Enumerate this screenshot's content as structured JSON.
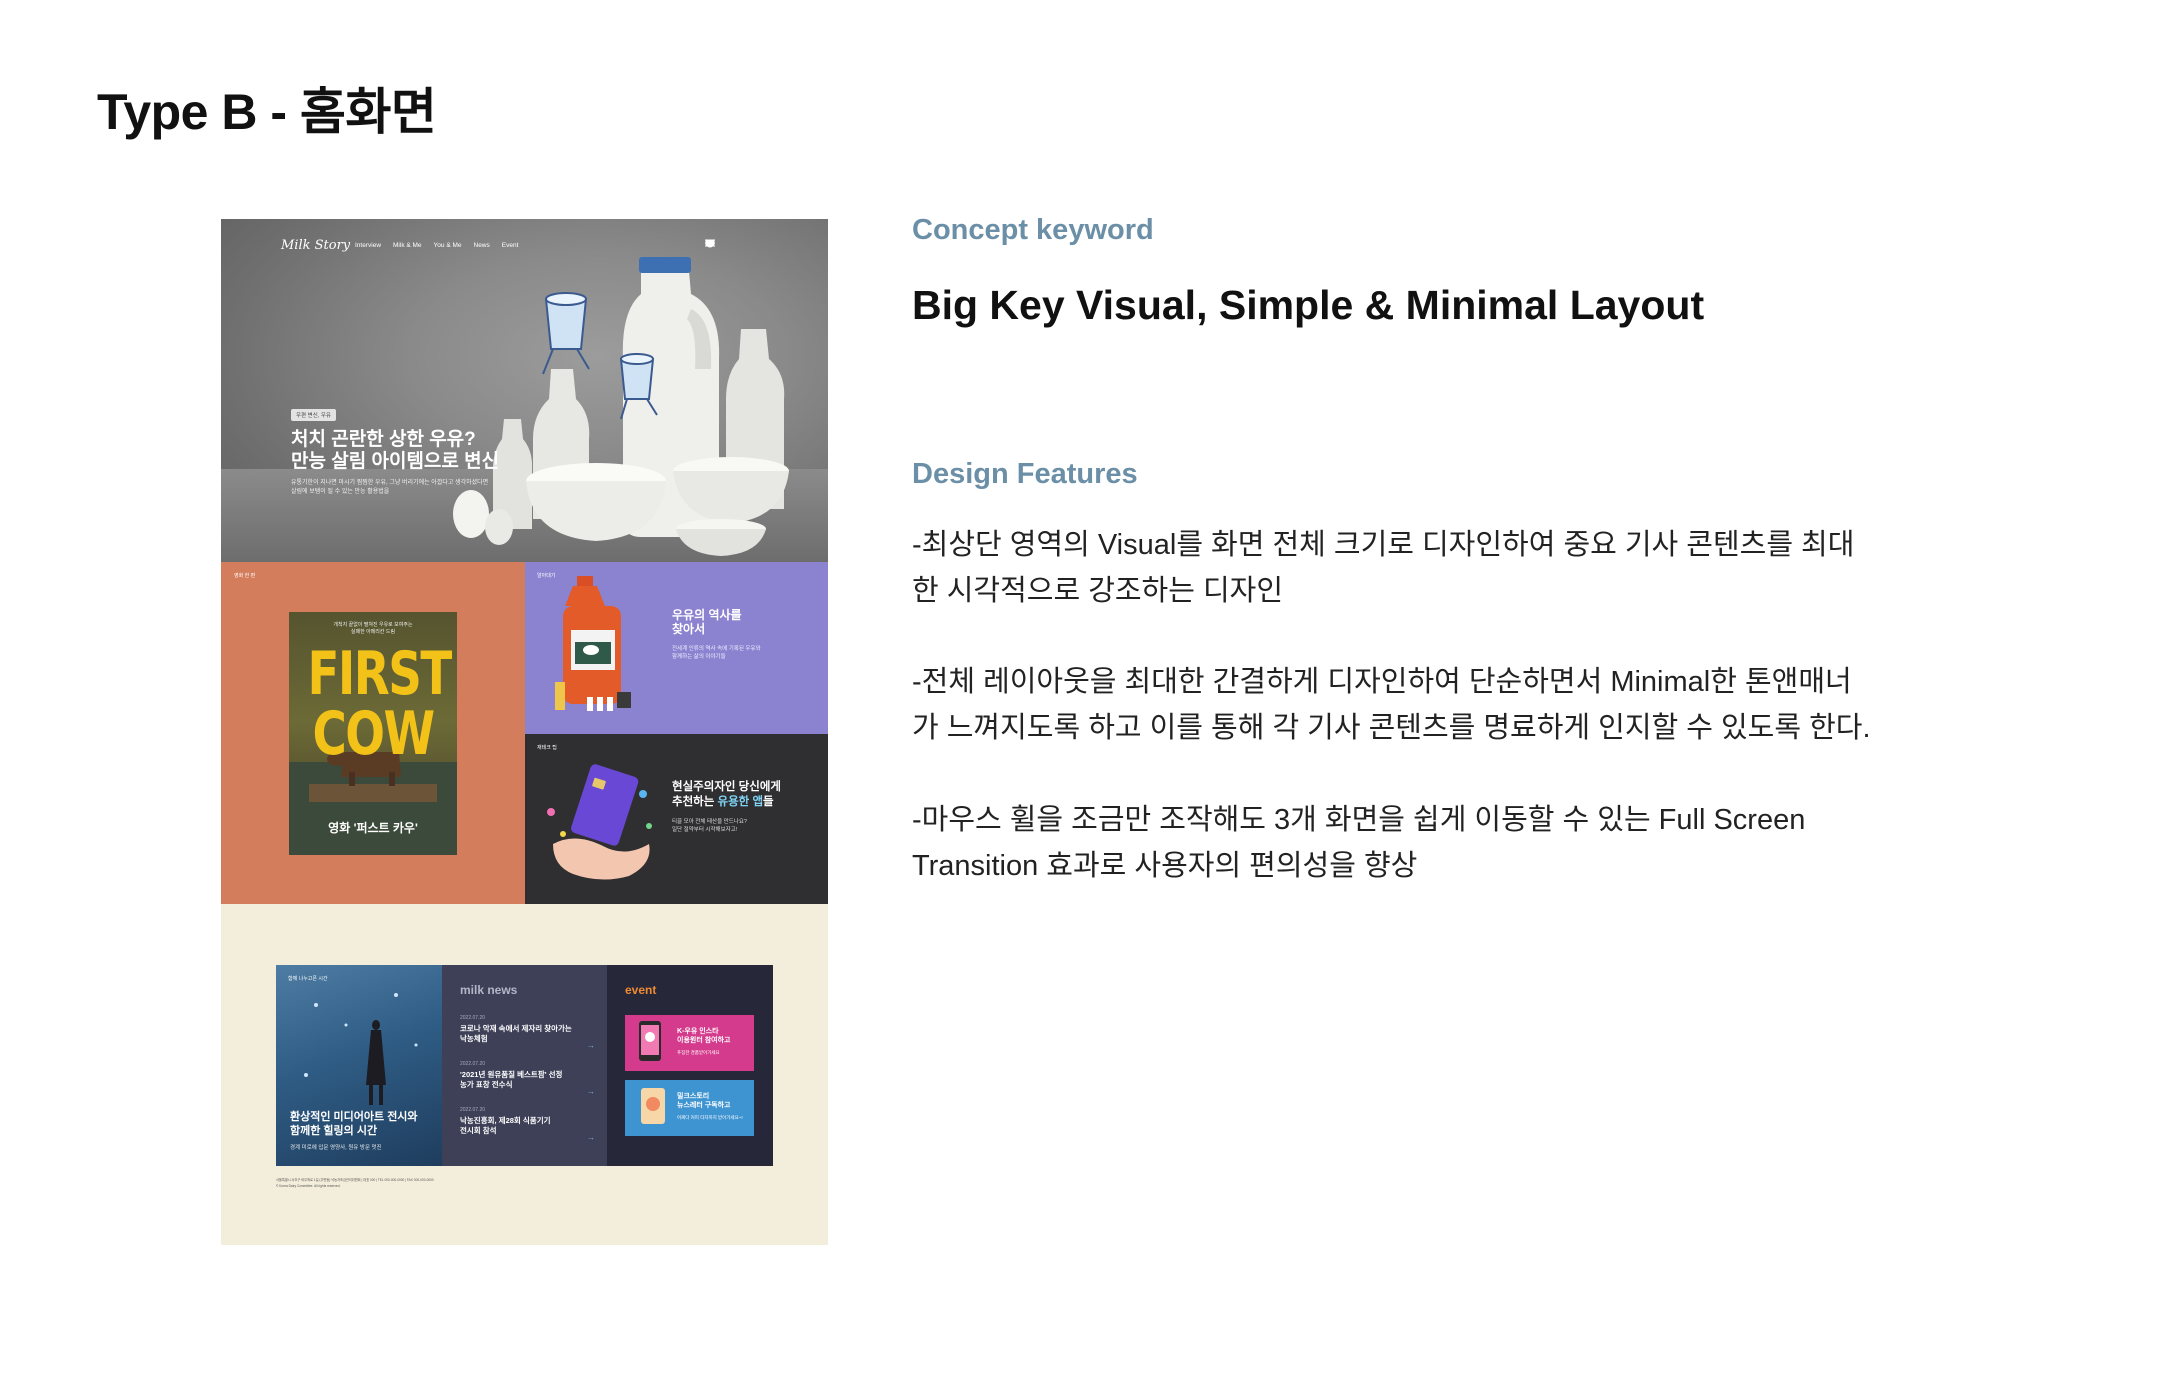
{
  "page": {
    "title": "Type B - 홈화면"
  },
  "mockup": {
    "nav": {
      "logo": "Milk Story",
      "links": [
        "Interview",
        "Milk & Me",
        "You & Me",
        "News",
        "Event"
      ],
      "icons": [
        "chat-icon",
        "message-icon",
        "menu-icon"
      ]
    },
    "hero": {
      "tag": "우편 변신, 우유",
      "title_lines": [
        "처치 곤란한 상한 우유?",
        "만능 살림 아이템으로 변신"
      ],
      "desc_lines": [
        "유통기한이 지나면 마시기 찜찜한 우유, 그냥 버리기에는 아깝다고 생각하셨다면",
        "살림에 보탬이 될 수 있는 만능 활용법을"
      ]
    },
    "movie_card": {
      "label": "영화 한 편",
      "poster_tag_lines": [
        "개척지 끝없이 펼쳐진 우유로 보여주는",
        "실패한 아메리칸 드림"
      ],
      "poster_title_1": "FIRST",
      "poster_title_2": "COW",
      "caption": "영화 '퍼스트 카우'"
    },
    "history_card": {
      "label": "알아대기",
      "title_lines": [
        "우유의 역사를",
        "찾아서"
      ],
      "desc_lines": [
        "전세계 인류의 역사 속에 기록된 우유와",
        "함께하는 삶의 이야기들"
      ]
    },
    "app_card": {
      "label": "재테크 팁",
      "title_line1": "현실주의자인 당신에게",
      "title_line2_pre": "추천하는 ",
      "title_line2_hl": "유용한 앱",
      "title_line2_post": "들",
      "desc_lines": [
        "티끌 모아 전체 태산을 만드나요?",
        "일단 절약부터 시작해보자고!"
      ]
    },
    "photo_panel": {
      "label": "함께 나누고픈 시간",
      "title_lines": [
        "환상적인 미디어아트 전시와",
        "함께한 힐링의 시간"
      ],
      "subtitle": "경계 미로에 입문 영양사, 원유 방문 멋진"
    },
    "news": {
      "heading": "milk news",
      "items": [
        {
          "date": "2022.07.20",
          "title_lines": [
            "코로나 악재 속에서 제자리 찾아가는",
            "낙농체험"
          ]
        },
        {
          "date": "2022.07.20",
          "title_lines": [
            "'2021년 원유품질 베스트팜' 선정",
            "농가 표창 전수식"
          ]
        },
        {
          "date": "2022.07.20",
          "title_lines": [
            "낙농진흥회, 제28회 식품기기",
            "전시회 참석"
          ]
        }
      ]
    },
    "event": {
      "heading": "event",
      "items": [
        {
          "title_lines": [
            "K-우유 인스타",
            "이용원터 참여하고"
          ],
          "sub": "푸짐한 경품받아가세요",
          "color": "#d43b8c"
        },
        {
          "title_lines": [
            "밀크스토리",
            "뉴스레터 구독하고"
          ],
          "sub": "어쩌다 커피 타자까지 받아가세요~!",
          "color": "#3e93d1"
        }
      ]
    },
    "footer_lines": [
      "서울특별시 서초구 바우뫼로 1길 (우면동) 낙농자조금관리위원회 | 대표 000 | TEL 000-000-0000 | FAX 000-000-0000",
      "© Korea Dairy Committee. All rights reserved."
    ]
  },
  "concept": {
    "label": "Concept keyword",
    "heading": "Big Key Visual, Simple & Minimal Layout"
  },
  "design": {
    "label": "Design Features",
    "features": [
      [
        "-최상단 영역의 Visual를 화면 전체 크기로 디자인하여 중요 기사 콘텐츠를 최대",
        "한 시각적으로 강조하는 디자인"
      ],
      [
        "-전체 레이아웃을 최대한 간결하게 디자인하여 단순하면서 Minimal한 톤앤매너",
        "가 느껴지도록 하고 이를 통해 각 기사 콘텐츠를 명료하게 인지할 수 있도록 한다."
      ],
      [
        "-마우스 휠을 조금만 조작해도 3개 화면을 쉽게 이동할 수 있는 Full Screen",
        "Transition 효과로 사용자의 편의성을 향상"
      ]
    ]
  },
  "colors": {
    "accent": "#6b8fa6",
    "orange": "#d47d5d",
    "purple": "#8b82d0",
    "dark": "#2f2f31",
    "cream": "#f3eedb"
  }
}
